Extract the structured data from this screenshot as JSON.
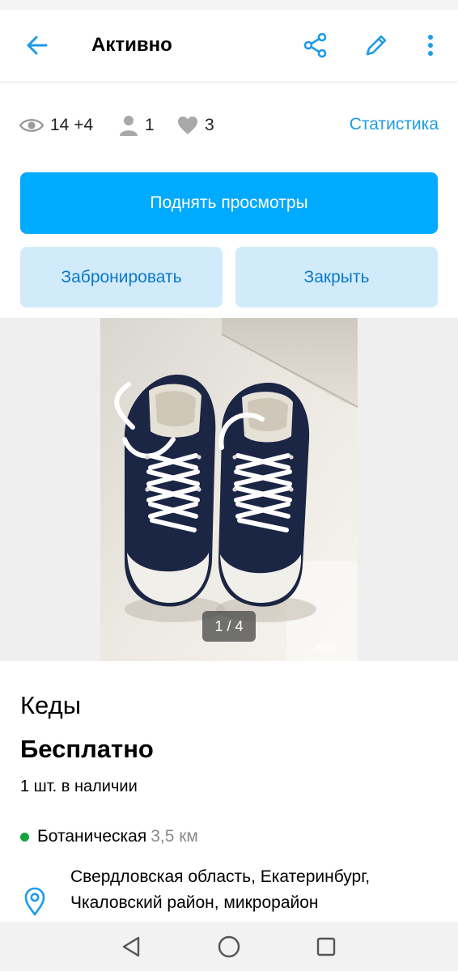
{
  "app_bar": {
    "title": "Активно"
  },
  "stats": {
    "views": "14 +4",
    "contacts": "1",
    "favorites": "3",
    "link_label": "Статистика"
  },
  "actions": {
    "promote_label": "Поднять просмотры",
    "reserve_label": "Забронировать",
    "close_label": "Закрыть"
  },
  "gallery": {
    "counter": "1 / 4",
    "watermark": "Avito"
  },
  "item": {
    "title": "Кеды",
    "price": "Бесплатно",
    "stock": "1 шт. в наличии"
  },
  "location": {
    "metro_station": "Ботаническая",
    "metro_distance": "3,5 км",
    "address_line1": "Свердловская область, Екатеринбург,",
    "address_line2": "Чкаловский район, микрорайон"
  },
  "colors": {
    "accent": "#00aaff",
    "link": "#1e9be8",
    "secondary_bg": "#d2ebfb",
    "metro_green": "#15a43b"
  }
}
